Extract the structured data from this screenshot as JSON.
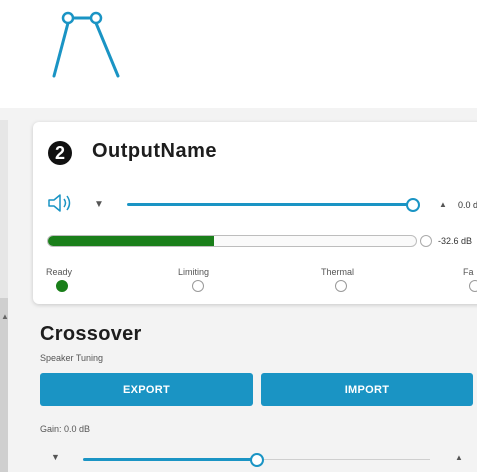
{
  "output": {
    "number": "2",
    "name": "OutputName",
    "volume_value": "0.0 d",
    "volume_level": 0.98,
    "meter_value": "-32.6 dB",
    "meter_level": 0.45
  },
  "status": [
    {
      "label": "Ready",
      "active": true
    },
    {
      "label": "Limiting",
      "active": false
    },
    {
      "label": "Thermal",
      "active": false
    },
    {
      "label": "Fa",
      "active": false
    }
  ],
  "crossover": {
    "title": "Crossover",
    "subtitle": "Speaker Tuning",
    "export_label": "EXPORT",
    "import_label": "IMPORT",
    "gain_label": "Gain: 0.0 dB",
    "gain_level": 0.5
  },
  "colors": {
    "accent": "#1a94c4",
    "ok_green": "#1a7f1a"
  },
  "icons": [
    "crossover-logo-icon",
    "speaker-icon",
    "chevron-down-icon",
    "chevron-up-icon"
  ]
}
